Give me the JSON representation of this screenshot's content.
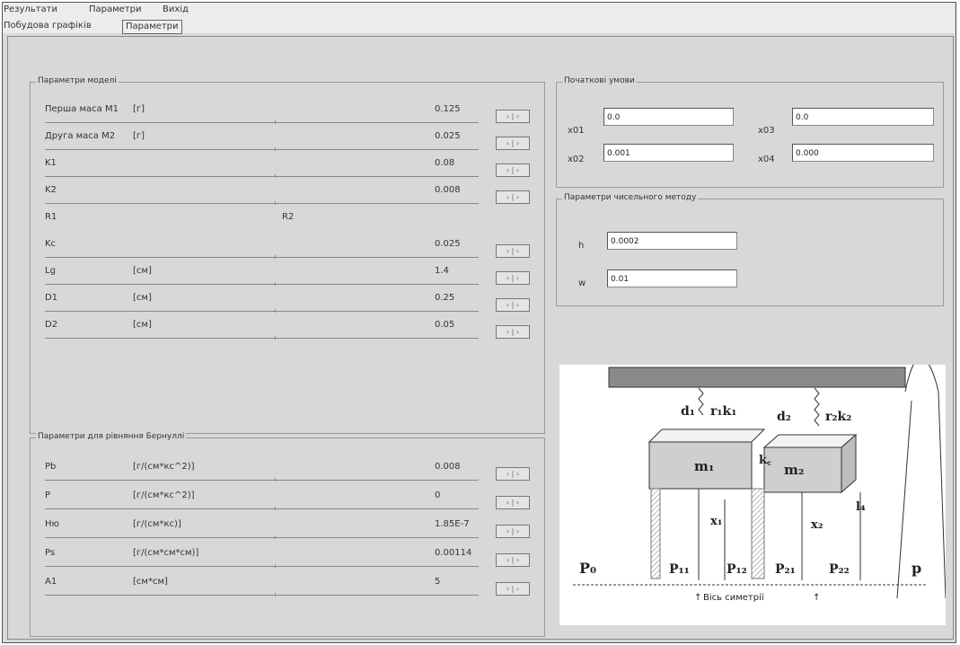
{
  "menu": [
    "Результати",
    "Параметри",
    "Вихід"
  ],
  "tabs": [
    "Побудова графіків",
    "Параметри"
  ],
  "model_group": {
    "title": "Параметри моделі",
    "rows": [
      {
        "label": "Перша маса M1",
        "unit": "[г]",
        "value": "0.125"
      },
      {
        "label": "Друга маса M2",
        "unit": "[г]",
        "value": "0.025"
      },
      {
        "label": "K1",
        "unit": "",
        "value": "0.08"
      },
      {
        "label": "K2",
        "unit": "",
        "value": "0.008"
      },
      {
        "label": "Kc",
        "unit": "",
        "value": "0.025"
      },
      {
        "label": "Lg",
        "unit": "[см]",
        "value": "1.4"
      },
      {
        "label": "D1",
        "unit": "[см]",
        "value": "0.25"
      },
      {
        "label": "D2",
        "unit": "[см]",
        "value": "0.05"
      }
    ],
    "r1_label": "R1",
    "r2_label": "R2"
  },
  "bernoulli_group": {
    "title": "Параметри для рівняння Бернуллі",
    "rows": [
      {
        "label": "Pb",
        "unit": "[г/(см*кс^2)]",
        "value": "0.008"
      },
      {
        "label": "P",
        "unit": "[г/(см*кс^2)]",
        "value": "0"
      },
      {
        "label": "Hю",
        "unit": "[г/(см*кс)]",
        "value": "1.85E-7"
      },
      {
        "label": "Ps",
        "unit": "[г/(см*см*см)]",
        "value": "0.00114"
      },
      {
        "label": "A1",
        "unit": "[см*см]",
        "value": "5"
      }
    ]
  },
  "spin_label": "‹ | ›",
  "init_group": {
    "title": "Початкові умови",
    "fields": [
      {
        "label": "x01",
        "value": "0.0"
      },
      {
        "label": "x03",
        "value": "0.0"
      },
      {
        "label": "x02",
        "value": "0.001"
      },
      {
        "label": "x04",
        "value": "0.000"
      }
    ]
  },
  "numeric_group": {
    "title": "Параметри чисельного методу",
    "fields": [
      {
        "label": "h",
        "value": "0.0002"
      },
      {
        "label": "w",
        "value": "0.01"
      }
    ]
  },
  "diagram": {
    "d1": "d₁",
    "r1k1": "r₁k₁",
    "d2": "d₂",
    "r2k2": "r₂k₂",
    "m1": "m₁",
    "m2": "m₂",
    "kc": "k꜀",
    "x1": "x₁",
    "x2": "x₂",
    "l": "l₄",
    "p0": "P₀",
    "p11": "P₁₁",
    "p12": "P₁₂",
    "p21": "P₂₁",
    "p22": "P₂₂",
    "p": "p",
    "axis": "Вісь симетрії"
  }
}
